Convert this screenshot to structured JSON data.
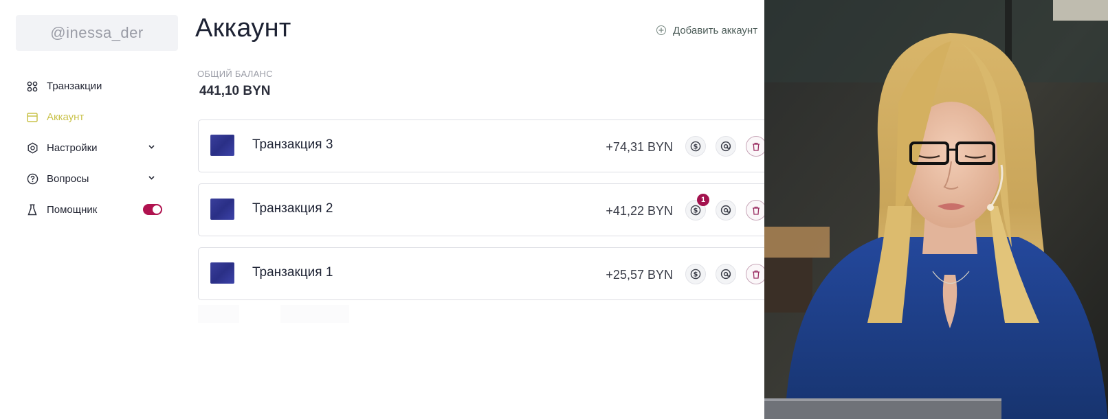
{
  "sidebar": {
    "username": "@inessa_der",
    "items": [
      {
        "label": "Транзакции",
        "icon": "grid-icon",
        "active": false,
        "has_chevron": false
      },
      {
        "label": "Аккаунт",
        "icon": "card-icon",
        "active": true,
        "has_chevron": false
      },
      {
        "label": "Настройки",
        "icon": "settings-icon",
        "active": false,
        "has_chevron": true
      },
      {
        "label": "Вопросы",
        "icon": "help-icon",
        "active": false,
        "has_chevron": true
      },
      {
        "label": "Помощник",
        "icon": "flask-icon",
        "active": false,
        "has_toggle": true,
        "toggle_on": true
      }
    ],
    "active_color": "#c9c24a",
    "toggle_color": "#b0124f"
  },
  "header": {
    "title": "Аккаунт",
    "add_account_label": "Добавить аккаунт"
  },
  "balance": {
    "label": "ОБЩИЙ БАЛАНС",
    "value": "441,10 BYN"
  },
  "transactions": [
    {
      "name": "Транзакция 3",
      "amount": "+74,31 BYN",
      "badge": ""
    },
    {
      "name": "Транзакция 2",
      "amount": "+41,22 BYN",
      "badge": "1"
    },
    {
      "name": "Транзакция 1",
      "amount": "+25,57 BYN",
      "badge": ""
    }
  ],
  "colors": {
    "badge": "#a3124e",
    "thumb": "#2f3490",
    "presenter_top": "#1f3f8e"
  }
}
